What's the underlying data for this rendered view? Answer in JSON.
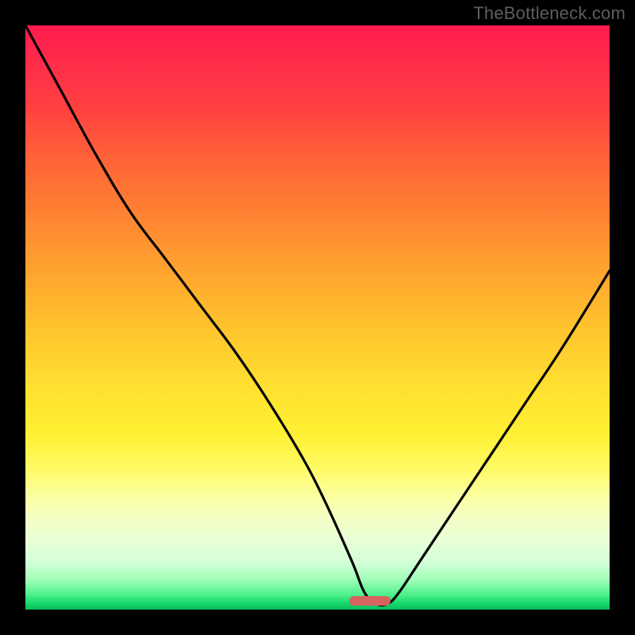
{
  "watermark": "TheBottleneck.com",
  "colors": {
    "frame": "#000000",
    "curve": "#000000",
    "marker": "#d6635f"
  },
  "marker": {
    "x_frac_start": 0.555,
    "x_frac_end": 0.625,
    "y_frac": 0.985
  },
  "chart_data": {
    "type": "line",
    "title": "",
    "xlabel": "",
    "ylabel": "",
    "xlim": [
      0,
      100
    ],
    "ylim": [
      0,
      100
    ],
    "series": [
      {
        "name": "bottleneck-curve",
        "x": [
          0,
          6,
          12,
          18,
          24,
          30,
          36,
          42,
          48,
          52,
          56,
          58,
          60,
          62,
          64,
          68,
          74,
          80,
          86,
          92,
          100
        ],
        "y": [
          100,
          89,
          78,
          68,
          60,
          52,
          44,
          35,
          25,
          17,
          8,
          3,
          1,
          1,
          3,
          9,
          18,
          27,
          36,
          45,
          58
        ]
      }
    ],
    "annotations": [
      {
        "type": "marker",
        "shape": "pill",
        "x_range": [
          55.5,
          62.5
        ],
        "y": 1.5
      }
    ],
    "background_gradient": {
      "direction": "vertical",
      "stops": [
        {
          "pos": 0.0,
          "color": "#ff1a4d"
        },
        {
          "pos": 0.5,
          "color": "#ffca2e"
        },
        {
          "pos": 0.8,
          "color": "#fcff9a"
        },
        {
          "pos": 1.0,
          "color": "#0dbb5c"
        }
      ]
    }
  }
}
